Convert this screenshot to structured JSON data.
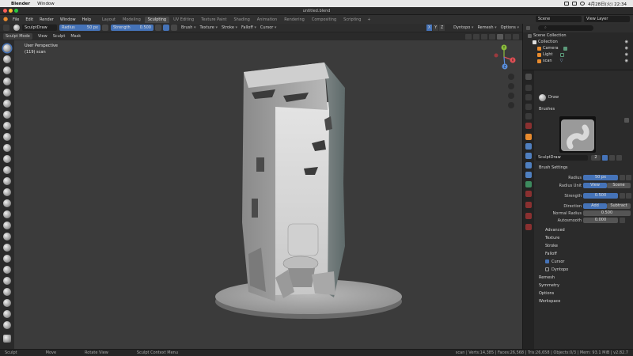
{
  "mac_menubar": {
    "app": "Blender",
    "items": [
      "Window"
    ],
    "clock": "4月28日(火)  22:34"
  },
  "window": {
    "title": "untitled.blend"
  },
  "topbar": {
    "menus": [
      "File",
      "Edit",
      "Render",
      "Window",
      "Help"
    ],
    "tabs": [
      "Layout",
      "Modeling",
      "Sculpting",
      "UV Editing",
      "Texture Paint",
      "Shading",
      "Animation",
      "Rendering",
      "Compositing",
      "Scripting"
    ],
    "active_tab": "Sculpting",
    "add_tab": "+",
    "scene": "Scene",
    "view_layer": "View Layer"
  },
  "tool_settings": {
    "brush_name": "SculptDraw",
    "radius_label": "Radius",
    "radius_value": "50 px",
    "strength_label": "Strength",
    "strength_value": "0.500",
    "dropdowns": [
      "Brush",
      "Texture",
      "Stroke",
      "Falloff",
      "Cursor"
    ],
    "axes": [
      "X",
      "Y",
      "Z"
    ],
    "dyntopo": "Dyntopo",
    "remesh": "Remesh",
    "options": "Options"
  },
  "viewport_header": {
    "mode": "Sculpt Mode",
    "menus": [
      "View",
      "Sculpt",
      "Mask"
    ]
  },
  "viewport": {
    "perspective": "User Perspective",
    "object_info": "(119) scan",
    "gizmo_axes": [
      "Y",
      "X",
      "Z"
    ]
  },
  "outliner": {
    "title": "Scene Collection",
    "rows": [
      {
        "label": "Collection"
      },
      {
        "label": "Camera"
      },
      {
        "label": "Light"
      },
      {
        "label": "scan"
      }
    ]
  },
  "properties": {
    "tool_name": "Draw",
    "brushes_label": "Brushes",
    "brush_name": "SculptDraw",
    "brush_users": "2",
    "brush_settings_label": "Brush Settings",
    "radius_label": "Radius",
    "radius_value": "50 px",
    "radius_unit_label": "Radius Unit",
    "radius_unit_options": [
      "View",
      "Scene"
    ],
    "strength_label": "Strength",
    "strength_value": "0.500",
    "direction_label": "Direction",
    "direction_options": [
      "Add",
      "Subtract"
    ],
    "normal_radius_label": "Normal Radius",
    "normal_radius_value": "0.500",
    "autosmooth_label": "Autosmooth",
    "autosmooth_value": "0.000",
    "subpanels": [
      "Advanced",
      "Texture",
      "Stroke",
      "Falloff",
      "Cursor"
    ],
    "sections": [
      "Dyntopo",
      "Remesh",
      "Symmetry",
      "Options",
      "Workspace"
    ]
  },
  "statusbar": {
    "hints": [
      "Sculpt",
      "Move",
      "Rotate View",
      "Sculpt Context Menu"
    ],
    "stats": "scan | Verts:14,385 | Faces:26,568 | Tris:26,658 | Objects:0/3 | Mem: 93.1 MiB | v2.82.7"
  },
  "colors": {
    "accent_blue": "#4573b8",
    "active_orange": "#e88b2e",
    "viewport_bg": "#3b3b3b"
  }
}
